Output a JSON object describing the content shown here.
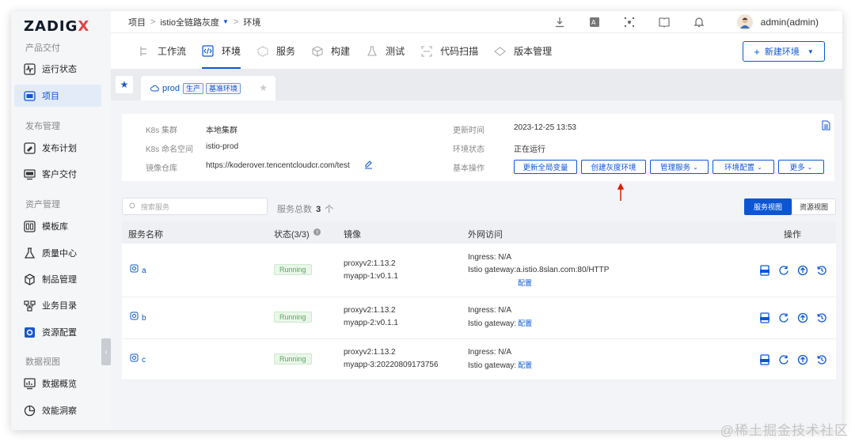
{
  "app": {
    "logo_main": "ZADIG",
    "logo_accent": "X"
  },
  "sidebar": {
    "sections": [
      {
        "title": "产品交付",
        "items": [
          {
            "label": "运行状态",
            "icon": "pulse-icon"
          },
          {
            "label": "项目",
            "icon": "project-icon",
            "active": true
          }
        ]
      },
      {
        "title": "发布管理",
        "items": [
          {
            "label": "发布计划",
            "icon": "plan-icon"
          },
          {
            "label": "客户交付",
            "icon": "delivery-icon"
          }
        ]
      },
      {
        "title": "资产管理",
        "items": [
          {
            "label": "模板库",
            "icon": "template-icon"
          },
          {
            "label": "质量中心",
            "icon": "quality-icon"
          },
          {
            "label": "制品管理",
            "icon": "artifact-icon"
          },
          {
            "label": "业务目录",
            "icon": "catalog-icon"
          },
          {
            "label": "资源配置",
            "icon": "resource-icon"
          }
        ]
      },
      {
        "title": "数据视图",
        "items": [
          {
            "label": "数据概览",
            "icon": "overview-icon"
          },
          {
            "label": "效能洞察",
            "icon": "insight-icon"
          }
        ]
      }
    ],
    "collapse": "‹"
  },
  "header": {
    "breadcrumb": [
      "项目",
      "istio全链路灰度",
      "环境"
    ],
    "username": "admin(admin)"
  },
  "tabs": [
    {
      "label": "工作流",
      "icon": "workflow-icon"
    },
    {
      "label": "环境",
      "icon": "code-icon",
      "active": true
    },
    {
      "label": "服务",
      "icon": "cube-icon"
    },
    {
      "label": "构建",
      "icon": "box-icon"
    },
    {
      "label": "测试",
      "icon": "flask-icon"
    },
    {
      "label": "代码扫描",
      "icon": "scan-icon"
    },
    {
      "label": "版本管理",
      "icon": "version-icon"
    }
  ],
  "new_env_button": "新建环境",
  "env_tab": {
    "name": "prod",
    "tags": [
      "生产",
      "基准环境"
    ]
  },
  "info": {
    "cluster_label": "K8s 集群",
    "cluster_value": "本地集群",
    "namespace_label": "K8s 命名空间",
    "namespace_value": "istio-prod",
    "registry_label": "镜像仓库",
    "registry_value": "https://koderover.tencentcloudcr.com/test",
    "updated_label": "更新时间",
    "updated_value": "2023-12-25 13:53",
    "status_label": "环境状态",
    "status_value": "正在运行",
    "ops_label": "基本操作",
    "ops": [
      "更新全局变量",
      "创建灰度环境",
      "管理服务 ",
      "环境配置 ",
      "更多 "
    ]
  },
  "search": {
    "placeholder": "搜索服务"
  },
  "service_total": {
    "label": "服务总数",
    "count": "3",
    "unit": "个"
  },
  "views": {
    "service": "服务视图",
    "resource": "资源视图"
  },
  "table": {
    "headers": {
      "name": "服务名称",
      "status": "状态(3/3)",
      "image": "镜像",
      "access": "外网访问",
      "ops": "操作"
    },
    "rows": [
      {
        "name": "a",
        "status": "Running",
        "image1": "proxyv2:1.13.2",
        "image2": "myapp-1:v0.1.1",
        "ingress": "Ingress: N/A",
        "gateway_label": "Istio gateway:",
        "gateway_value": "a.istio.8slan.com:80/HTTP",
        "config": "配置"
      },
      {
        "name": "b",
        "status": "Running",
        "image1": "proxyv2:1.13.2",
        "image2": "myapp-2:v0.1.1",
        "ingress": "Ingress: N/A",
        "gateway_label": "Istio gateway:",
        "gateway_value": "",
        "config": "配置"
      },
      {
        "name": "c",
        "status": "Running",
        "image1": "proxyv2:1.13.2",
        "image2": "myapp-3:20220809173756",
        "ingress": "Ingress: N/A",
        "gateway_label": "Istio gateway:",
        "gateway_value": "",
        "config": "配置"
      }
    ]
  },
  "watermark": "@稀土掘金技术社区"
}
